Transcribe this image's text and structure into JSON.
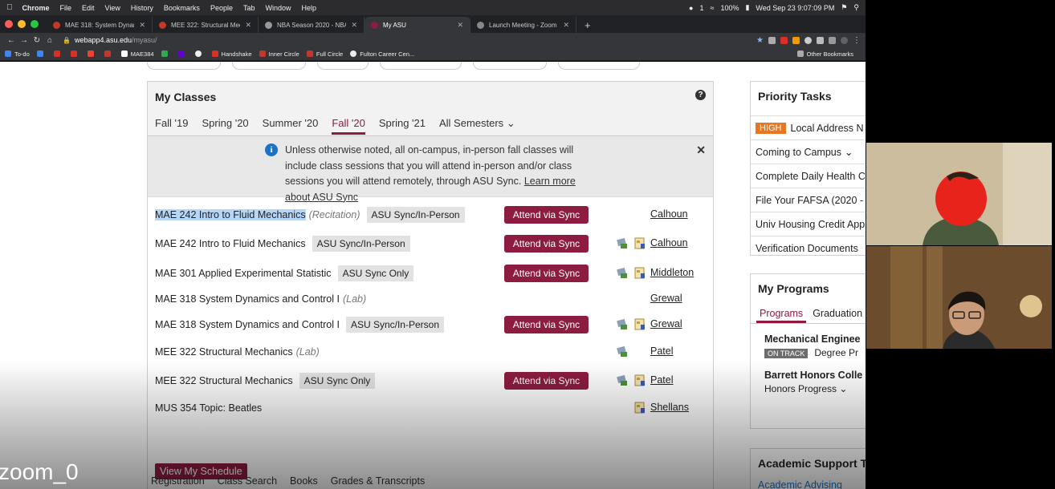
{
  "menubar": {
    "app": "Chrome",
    "items": [
      "File",
      "Edit",
      "View",
      "History",
      "Bookmarks",
      "People",
      "Tab",
      "Window",
      "Help"
    ],
    "battery": "100%",
    "clock": "Wed Sep 23  9:07:09 PM",
    "badge_count": "1"
  },
  "tabs": [
    {
      "title": "MAE 318: System Dynamics an",
      "color": "#c0392b"
    },
    {
      "title": "MEE 322: Structural Mechanic",
      "color": "#c0392b"
    },
    {
      "title": "NBA Season 2020 - NBA Strea",
      "color": "#999999"
    },
    {
      "title": "My ASU",
      "color": "#8c1d40",
      "active": true
    },
    {
      "title": "Launch Meeting - Zoom",
      "color": "#888888"
    }
  ],
  "address": {
    "host": "webapp4.asu.edu",
    "path": "/myasu/"
  },
  "bookmarks": [
    "To-do",
    "",
    "",
    "",
    "",
    "",
    "MAE384",
    "",
    "",
    "",
    "Handshake",
    "Inner Circle",
    "Full Circle",
    "Fulton Career Cen..."
  ],
  "bookmarks_other": "Other Bookmarks",
  "classes": {
    "title": "My Classes",
    "semesters": [
      "Fall '19",
      "Spring '20",
      "Summer '20",
      "Fall '20",
      "Spring '21"
    ],
    "all_semesters": "All Semesters",
    "active_semester": 3,
    "notice": {
      "text": "Unless otherwise noted, all on-campus, in-person fall classes will include class sessions that you will attend in-person and/or class sessions you will attend remotely, through ASU Sync.",
      "link": "Learn more about ASU Sync"
    },
    "rows": [
      {
        "name": "MAE 242 Intro to Fluid Mechanics",
        "type": "(Recitation)",
        "badge": "ASU Sync/In-Person",
        "sync": true,
        "icon_a": false,
        "icon_b": false,
        "instructor": "Calhoun",
        "highlight": true
      },
      {
        "name": "MAE 242 Intro to Fluid Mechanics",
        "type": "",
        "badge": "ASU Sync/In-Person",
        "sync": true,
        "icon_a": true,
        "icon_b": true,
        "instructor": "Calhoun"
      },
      {
        "name": "MAE 301 Applied Experimental Statistic",
        "type": "",
        "badge": "ASU Sync Only",
        "sync": true,
        "icon_a": true,
        "icon_b": true,
        "instructor": "Middleton"
      },
      {
        "name": "MAE 318 System Dynamics and Control I",
        "type": "(Lab)",
        "badge": "",
        "sync": false,
        "icon_a": false,
        "icon_b": false,
        "instructor": "Grewal"
      },
      {
        "name": "MAE 318 System Dynamics and Control I",
        "type": "",
        "badge": "ASU Sync/In-Person",
        "sync": true,
        "icon_a": true,
        "icon_b": true,
        "instructor": "Grewal"
      },
      {
        "name": "MEE 322 Structural Mechanics",
        "type": "(Lab)",
        "badge": "",
        "sync": false,
        "icon_a": true,
        "icon_b": false,
        "instructor": "Patel"
      },
      {
        "name": "MEE 322 Structural Mechanics",
        "type": "",
        "badge": "ASU Sync Only",
        "sync": true,
        "icon_a": true,
        "icon_b": true,
        "instructor": "Patel"
      },
      {
        "name": "MUS 354 Topic: Beatles",
        "type": "",
        "badge": "",
        "sync": false,
        "icon_a": false,
        "icon_b": true,
        "instructor": "Shellans"
      }
    ],
    "sync_label": "Attend via Sync",
    "schedule_button": "View My Schedule",
    "footer_links": [
      "Registration",
      "Class Search",
      "Books",
      "Grades & Transcripts"
    ]
  },
  "priority": {
    "title": "Priority Tasks",
    "high_label": "HIGH",
    "tasks": [
      "Local Address N",
      "Coming to Campus",
      "Complete Daily Health C",
      "File Your FAFSA (2020 -",
      "Univ Housing Credit App",
      "Verification Documents"
    ]
  },
  "programs": {
    "title": "My Programs",
    "tabs": [
      "Programs",
      "Graduation"
    ],
    "items": [
      {
        "name": "Mechanical Enginee",
        "status": "ON TRACK",
        "sub": "Degree Pr"
      },
      {
        "name": "Barrett Honors Colle",
        "status": "",
        "sub": "Honors Progress"
      }
    ]
  },
  "support": {
    "title": "Academic Support T",
    "link": "Academic Advising"
  },
  "zoom": {
    "label": "zoom_0"
  },
  "colors": {
    "asu_maroon": "#8c1d40",
    "high_orange": "#e87722",
    "info_blue": "#1a73c7"
  }
}
